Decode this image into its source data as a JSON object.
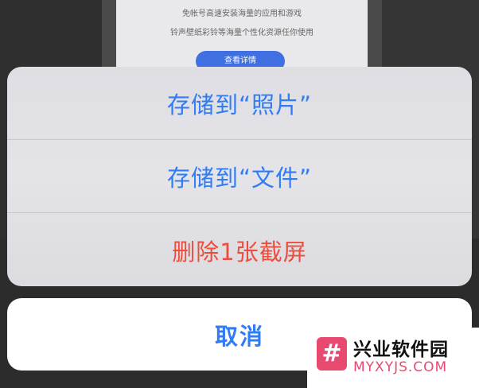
{
  "background": {
    "line1": "免帐号高速安装海量的应用和游戏",
    "line2": "铃声壁纸彩铃等海量个性化资源任你使用",
    "button_label": "查看详情"
  },
  "action_sheet": {
    "items": [
      {
        "label": "存储到“照片”"
      },
      {
        "label": "存储到“文件”"
      },
      {
        "label": "删除1张截屏"
      }
    ],
    "cancel_label": "取消"
  },
  "watermark": {
    "logo_glyph": "#",
    "title": "兴业软件园",
    "url": "MYXYJS.COM"
  },
  "colors": {
    "accent": "#2f7cf6",
    "destructive": "#ec4d3c",
    "watermark": "#e84a6f"
  }
}
